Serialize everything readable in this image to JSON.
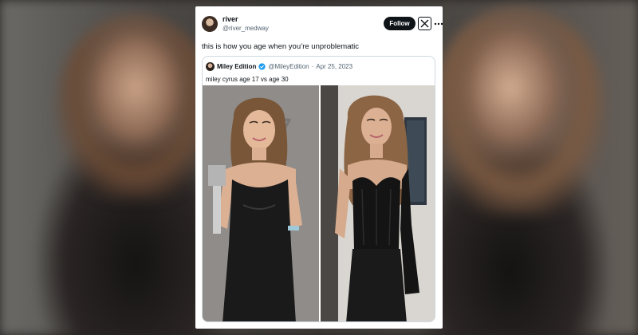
{
  "tweet": {
    "author_name": "river",
    "author_handle": "@river_medway",
    "follow_label": "Follow",
    "more_icon": "more-dots-icon",
    "text": "this is how you age when you’re unproblematic"
  },
  "quote": {
    "author_name": "Miley Edition",
    "author_handle": "@MileyEdition",
    "separator": "·",
    "date": "Apr 25, 2023",
    "text": "miley cyrus age 17 vs age 30",
    "verified_color": "#1d9bf0"
  },
  "colors": {
    "follow_bg": "#0f1419",
    "border": "#cfd9de",
    "secondary_text": "#536471"
  }
}
